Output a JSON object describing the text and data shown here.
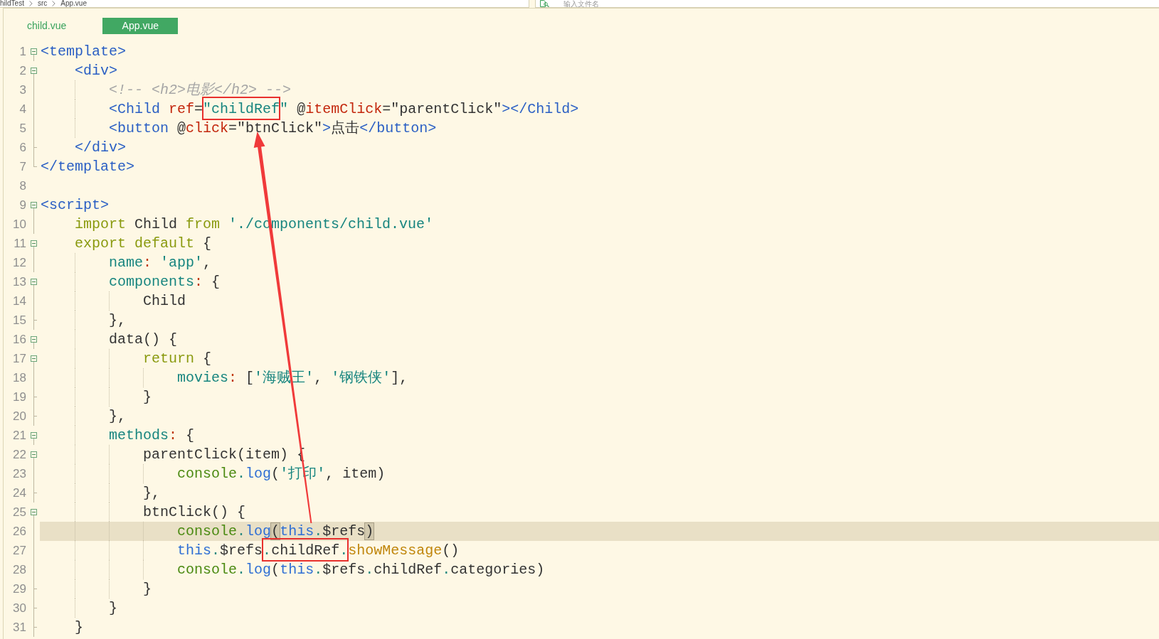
{
  "breadcrumb": [
    "hildTest",
    "src",
    "App.vue"
  ],
  "search": {
    "placeholder": "输入文件名"
  },
  "tabs": [
    {
      "label": "child.vue",
      "selected": false
    },
    {
      "label": "App.vue",
      "selected": true
    }
  ],
  "editor": {
    "lines": [
      {
        "number": "1",
        "kind": "open",
        "current": false,
        "tokens": [
          {
            "text": "<template>",
            "kind": "tag"
          }
        ]
      },
      {
        "number": "2",
        "kind": "open",
        "current": false,
        "tokens": [
          {
            "text": "    <div>",
            "kind": "tag"
          }
        ]
      },
      {
        "number": "3",
        "kind": "inside",
        "current": false,
        "tokens": [
          {
            "text": "        <!-- <h2>电影</h2> -->",
            "kind": "comment"
          }
        ]
      },
      {
        "number": "4",
        "kind": "inside",
        "current": false,
        "tokens": [
          {
            "text": "        <Child",
            "kind": "tag"
          },
          {
            "text": " ref",
            "kind": "attr"
          },
          {
            "text": "=",
            "kind": "plain"
          },
          {
            "text": "\"childRef",
            "kind": "string",
            "boxed": true
          },
          {
            "text": "\"",
            "kind": "string"
          },
          {
            "text": " @",
            "kind": "plain"
          },
          {
            "text": "itemClick",
            "kind": "attr"
          },
          {
            "text": "=\"parentClick\"",
            "kind": "plain"
          },
          {
            "text": "></Child>",
            "kind": "tag"
          }
        ]
      },
      {
        "number": "5",
        "kind": "inside",
        "current": false,
        "tokens": [
          {
            "text": "        <button",
            "kind": "tag"
          },
          {
            "text": " @",
            "kind": "plain"
          },
          {
            "text": "click",
            "kind": "attr"
          },
          {
            "text": "=\"btnClick\"",
            "kind": "plain"
          },
          {
            "text": ">",
            "kind": "tag"
          },
          {
            "text": "点击",
            "kind": "plain"
          },
          {
            "text": "</button>",
            "kind": "tag"
          }
        ]
      },
      {
        "number": "6",
        "kind": "end",
        "current": false,
        "tokens": [
          {
            "text": "    </div>",
            "kind": "tag"
          }
        ]
      },
      {
        "number": "7",
        "kind": "last",
        "current": false,
        "tokens": [
          {
            "text": "</template>",
            "kind": "tag"
          }
        ]
      },
      {
        "number": "8",
        "kind": "none",
        "current": false
      },
      {
        "number": "9",
        "kind": "open",
        "current": false,
        "tokens": [
          {
            "text": "<script>",
            "kind": "tag"
          }
        ]
      },
      {
        "number": "10",
        "kind": "inside",
        "current": false,
        "tokens": [
          {
            "text": "    import",
            "kind": "keyword"
          },
          {
            "text": " Child ",
            "kind": "plain"
          },
          {
            "text": "from",
            "kind": "keyword"
          },
          {
            "text": " './components/child.vue'",
            "kind": "string"
          }
        ]
      },
      {
        "number": "11",
        "kind": "open",
        "current": false,
        "tokens": [
          {
            "text": "    export default",
            "kind": "keyword"
          },
          {
            "text": " {",
            "kind": "plain"
          }
        ]
      },
      {
        "number": "12",
        "kind": "inside",
        "current": false,
        "tokens": [
          {
            "text": "        name",
            "kind": "prop"
          },
          {
            "text": ":",
            "kind": "colon"
          },
          {
            "text": " 'app'",
            "kind": "string"
          },
          {
            "text": ",",
            "kind": "plain"
          }
        ]
      },
      {
        "number": "13",
        "kind": "open",
        "current": false,
        "tokens": [
          {
            "text": "        components",
            "kind": "prop"
          },
          {
            "text": ":",
            "kind": "colon"
          },
          {
            "text": " {",
            "kind": "plain"
          }
        ]
      },
      {
        "number": "14",
        "kind": "inside",
        "current": false,
        "tokens": [
          {
            "text": "            Child",
            "kind": "plain"
          }
        ]
      },
      {
        "number": "15",
        "kind": "end",
        "current": false,
        "tokens": [
          {
            "text": "        },",
            "kind": "plain"
          }
        ]
      },
      {
        "number": "16",
        "kind": "open",
        "current": false,
        "tokens": [
          {
            "text": "        data() {",
            "kind": "plain"
          }
        ]
      },
      {
        "number": "17",
        "kind": "open",
        "current": false,
        "tokens": [
          {
            "text": "            return",
            "kind": "keyword"
          },
          {
            "text": " {",
            "kind": "plain"
          }
        ]
      },
      {
        "number": "18",
        "kind": "inside",
        "current": false,
        "tokens": [
          {
            "text": "                movies",
            "kind": "prop"
          },
          {
            "text": ":",
            "kind": "colon"
          },
          {
            "text": " [",
            "kind": "plain"
          },
          {
            "text": "'海贼王'",
            "kind": "string"
          },
          {
            "text": ", ",
            "kind": "plain"
          },
          {
            "text": "'钢铁侠'",
            "kind": "string"
          },
          {
            "text": "],",
            "kind": "plain"
          }
        ]
      },
      {
        "number": "19",
        "kind": "end",
        "current": false,
        "tokens": [
          {
            "text": "            }",
            "kind": "plain"
          }
        ]
      },
      {
        "number": "20",
        "kind": "end",
        "current": false,
        "tokens": [
          {
            "text": "        },",
            "kind": "plain"
          }
        ]
      },
      {
        "number": "21",
        "kind": "open",
        "current": false,
        "tokens": [
          {
            "text": "        methods",
            "kind": "prop"
          },
          {
            "text": ":",
            "kind": "colon"
          },
          {
            "text": " {",
            "kind": "plain"
          }
        ]
      },
      {
        "number": "22",
        "kind": "open",
        "current": false,
        "tokens": [
          {
            "text": "            parentClick(item) {",
            "kind": "plain"
          }
        ]
      },
      {
        "number": "23",
        "kind": "inside",
        "current": false,
        "tokens": [
          {
            "text": "                console",
            "kind": "object"
          },
          {
            "text": ".",
            "kind": "dot"
          },
          {
            "text": "log",
            "kind": "call"
          },
          {
            "text": "(",
            "kind": "plain"
          },
          {
            "text": "'打印'",
            "kind": "string"
          },
          {
            "text": ", item)",
            "kind": "plain"
          }
        ]
      },
      {
        "number": "24",
        "kind": "end",
        "current": false,
        "tokens": [
          {
            "text": "            },",
            "kind": "plain"
          }
        ]
      },
      {
        "number": "25",
        "kind": "open",
        "current": false,
        "tokens": [
          {
            "text": "            btnClick() {",
            "kind": "plain"
          }
        ]
      },
      {
        "number": "26",
        "kind": "inside",
        "current": true,
        "tokens": [
          {
            "text": "                console",
            "kind": "object"
          },
          {
            "text": ".",
            "kind": "dot"
          },
          {
            "text": "log",
            "kind": "call"
          },
          {
            "text": "(",
            "kind": "plain",
            "matched": true
          },
          {
            "text": "this",
            "kind": "this"
          },
          {
            "text": ".",
            "kind": "dot"
          },
          {
            "text": "$refs",
            "kind": "plain"
          },
          {
            "text": ")",
            "kind": "plain",
            "matched": true
          }
        ]
      },
      {
        "number": "27",
        "kind": "inside",
        "current": false,
        "tokens": [
          {
            "text": "                this",
            "kind": "this"
          },
          {
            "text": ".",
            "kind": "dot"
          },
          {
            "text": "$refs",
            "kind": "plain"
          },
          {
            "text": ".",
            "kind": "dot",
            "boxed": true
          },
          {
            "text": "childRef",
            "kind": "plain",
            "boxed": true
          },
          {
            "text": ".",
            "kind": "dot",
            "boxed": true
          },
          {
            "text": "showMessage",
            "kind": "method"
          },
          {
            "text": "()",
            "kind": "plain"
          }
        ]
      },
      {
        "number": "28",
        "kind": "inside",
        "current": false,
        "tokens": [
          {
            "text": "                console",
            "kind": "object"
          },
          {
            "text": ".",
            "kind": "dot"
          },
          {
            "text": "log",
            "kind": "call"
          },
          {
            "text": "(",
            "kind": "plain"
          },
          {
            "text": "this",
            "kind": "this"
          },
          {
            "text": ".",
            "kind": "dot"
          },
          {
            "text": "$refs",
            "kind": "plain"
          },
          {
            "text": ".",
            "kind": "dot"
          },
          {
            "text": "childRef",
            "kind": "plain"
          },
          {
            "text": ".",
            "kind": "dot"
          },
          {
            "text": "categories",
            "kind": "plain"
          },
          {
            "text": ")",
            "kind": "plain"
          }
        ]
      },
      {
        "number": "29",
        "kind": "end",
        "current": false,
        "tokens": [
          {
            "text": "            }",
            "kind": "plain"
          }
        ]
      },
      {
        "number": "30",
        "kind": "end",
        "current": false,
        "tokens": [
          {
            "text": "        }",
            "kind": "plain"
          }
        ]
      },
      {
        "number": "31",
        "kind": "end",
        "current": false,
        "tokens": [
          {
            "text": "    }",
            "kind": "plain"
          }
        ]
      }
    ]
  }
}
